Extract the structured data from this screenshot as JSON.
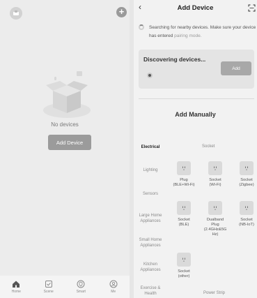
{
  "home": {
    "empty_text": "No devices",
    "add_button": "Add Device",
    "tabs": [
      {
        "label": "Home",
        "icon": "home-icon"
      },
      {
        "label": "Scene",
        "icon": "checkbox-icon"
      },
      {
        "label": "Smart",
        "icon": "shield-icon"
      },
      {
        "label": "Me",
        "icon": "user-icon"
      }
    ]
  },
  "add_device": {
    "title": "Add Device",
    "search_text": "Searching for nearby devices. Make sure your device has entered ",
    "search_link": "pairing mode.",
    "discovering_title": "Discovering devices...",
    "discover_add_button": "Add",
    "manual_title": "Add Manually",
    "categories": [
      {
        "label": "Electrical",
        "active": true
      },
      {
        "label": "Lighting",
        "active": false
      },
      {
        "label": "Sensors",
        "active": false
      },
      {
        "label": "Large Home Appliances",
        "active": false
      },
      {
        "label": "Small Home Appliances",
        "active": false
      },
      {
        "label": "Kitchen Appliances",
        "active": false
      },
      {
        "label": "Exercise & Health",
        "active": false
      }
    ],
    "socket_header": "Socket",
    "power_strip_header": "Power Strip",
    "devices": [
      {
        "label": "Plug\n(BLE+Wi-Fi)"
      },
      {
        "label": "Socket\n(Wi-Fi)"
      },
      {
        "label": "Socket\n(Zigbee)"
      },
      {
        "label": "Socket\n(BLE)"
      },
      {
        "label": "Dualband\nPlug\n(2.4GHz&5G\nHz)"
      },
      {
        "label": "Socket\n(NB-IoT)"
      },
      {
        "label": "Socket\n(other)"
      }
    ]
  },
  "colors": {
    "accent": "#9b9b9b",
    "background": "#ececec"
  }
}
